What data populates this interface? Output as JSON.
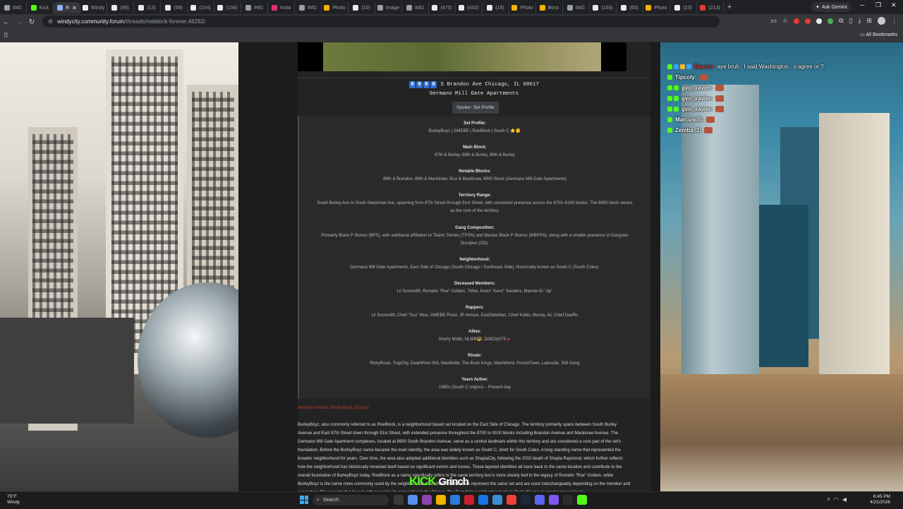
{
  "browser": {
    "tabs": [
      {
        "label": "IMG",
        "color": "#9aa0a6"
      },
      {
        "label": "Kick",
        "color": "#53fc18"
      },
      {
        "label": "R",
        "color": "#8ab4f8",
        "active": true
      },
      {
        "label": "Windy",
        "color": "#e8eaed"
      },
      {
        "label": "(99)",
        "color": "#e8eaed"
      },
      {
        "label": "(13)",
        "color": "#e8eaed"
      },
      {
        "label": "(59)",
        "color": "#e8eaed"
      },
      {
        "label": "(104)",
        "color": "#e8eaed"
      },
      {
        "label": "(156)",
        "color": "#e8eaed"
      },
      {
        "label": "IMG",
        "color": "#9aa0a6"
      },
      {
        "label": "Insta",
        "color": "#e1306c"
      },
      {
        "label": "IMG",
        "color": "#9aa0a6"
      },
      {
        "label": "Photo",
        "color": "#f4b400"
      },
      {
        "label": "(10)",
        "color": "#e8eaed"
      },
      {
        "label": "Image",
        "color": "#9aa0a6"
      },
      {
        "label": "IMG",
        "color": "#9aa0a6"
      },
      {
        "label": "(470)",
        "color": "#e8eaed"
      },
      {
        "label": "(432)",
        "color": "#e8eaed"
      },
      {
        "label": "(16)",
        "color": "#e8eaed"
      },
      {
        "label": "Photo",
        "color": "#f4b400"
      },
      {
        "label": "Boss",
        "color": "#f4b400"
      },
      {
        "label": "IMG",
        "color": "#9aa0a6"
      },
      {
        "label": "(159)",
        "color": "#e8eaed"
      },
      {
        "label": "(65)",
        "color": "#e8eaed"
      },
      {
        "label": "Photo",
        "color": "#f4b400"
      },
      {
        "label": "(23)",
        "color": "#e8eaed"
      },
      {
        "label": "(213)",
        "color": "#e53935"
      }
    ],
    "new_tab": "+",
    "ask_gemini": "Ask Gemini",
    "url_host": "windycity.community.forum",
    "url_path": "/threads/roeblock-forever.46262/",
    "all_bookmarks": "All Bookmarks"
  },
  "post": {
    "address_digits": [
      "8",
      "9",
      "0",
      "0"
    ],
    "address_rest": "S Brandon Ave Chicago, IL 60617",
    "complex": "Germano Mill Gate Apartments",
    "spoiler_button": "Spoiler: Set Profile",
    "sections": [
      {
        "heading": "Set Profile:",
        "text": "BurleyBoyz | GMEBE | RoeBlock | South C",
        "emoji": "⭐✊"
      },
      {
        "heading": "Main Block:",
        "text": "87th & Burley, 88th & Burley, 89th & Burley"
      },
      {
        "heading": "Notable Blocks:",
        "text": "88th & Brandon, 89th & Mackinaw, 91st & Mackinaw, 8900 Block (Germano Mill Gate Apartments)"
      },
      {
        "heading": "Territory Range:",
        "text": "South Burley Ave to South Mackinaw Ave, spanning from 87th Street through 91st Street, with consistent presence across the 8700–9100 blocks. The 8900 block serves as the core of the territory."
      },
      {
        "heading": "Gang Composition:",
        "text": "Primarily Black P Stones (BPS), with additional affiliation to Titanic Stones (TPSN) and Maniac Black P Stones (MBPSN), along with a smaller presence of Gangster Disciples (GD)."
      },
      {
        "heading": "Neighborhood:",
        "text": "Germano Mill Gate Apartments, East Side of Chicago (South Chicago / Southeast Side), historically known as South C (South Coles)."
      },
      {
        "heading": "Deceased Members:",
        "text": "Lil Scoom89, Romello \"Roe\" Golden, 7Moe, Kevin \"Kevo\" Sanders, Mannie-El \"Jip\""
      },
      {
        "heading": "Rappers:",
        "text": "Lil Scoom89, Chief \"Sco\" Moe, GMEBE Pistol, JP Armani, EastSideMari, Chief Kiddo, Murda, Ali, Chief DaeRo"
      },
      {
        "heading": "Allies:",
        "text": "Shorty Mobb, NLMB🔱, DrillCity079🔺"
      },
      {
        "heading": "Rivals:",
        "text": "RiskyRoad, TrapCity, DeathRow 083, MaxMobb, The Bush Kings, MainWorld, PocketTown, Lakeside, 358 Gang"
      },
      {
        "heading": "Years Active:",
        "text": "1980s (South C origins) – Present day"
      }
    ],
    "red_link": "Western Avenue: BurleyBoyz (Gangs)",
    "body_lines": [
      "BurleyBoyz, also commonly referred to as RoeBlock, is a neighborhood based set located on the East Side of Chicago. The territory primarily spans between South Burley",
      "Avenue and East 87th Street down through 91st Street, with extended presence throughout the 8700 to 9100 blocks including Brandon Avenue and Mackinaw Avenue. The",
      "Germano Mill Gate Apartment complexes, located at 8900 South Brandon Avenue, serve as a central landmark within this territory and are considered a core part of the set's",
      "foundation. Before the BurleyBoyz name became the main identity, the area was widely known as South C, short for South Coles. A long standing name that represented the",
      "broader neighborhood for years. Over time, the area also adopted additional identities such as ShaylaCity, following the 2010 death of Shayla Raymond, which further reflects",
      "how the neighborhood has historically renamed itself based on significant events and losses. These layered identities all trace back to the same location and contribute to the",
      "overall foundation of BurleyBoyz today. RoeBlock as a name specifically refers to the same territory but is more closely tied to the legacy of Romello \"Roe\" Golden, while",
      "BurleyBoyz is the name more commonly used by the neighborhood as a whole. Both names represent the same set and are used interchangeably depending on the member and",
      "generation. The area itself is heavily influenced by its connection to the Stones. The East Side neighborhood where BurleyBoyz is located is known for its"
    ]
  },
  "stream_overlay": {
    "kick_logo": "KICK",
    "streamer": "Grinch",
    "chat": [
      {
        "user": "BearsJ",
        "user_color": "#e53935",
        "message": "aye bruh.. I said Washington.. u agree or ?",
        "badges": [
          "b-kick",
          "b-blue",
          "b-gold",
          "b-blue"
        ]
      },
      {
        "user": "Tipcoly:",
        "user_color": "#ffffff",
        "emote": true,
        "badges": [
          "b-kick"
        ]
      },
      {
        "user": "gvo_xavier:",
        "user_color": "#ffffff",
        "emote": true,
        "badges": [
          "b-kick",
          "b-kick"
        ]
      },
      {
        "user": "gvo_xavier:",
        "user_color": "#ffffff",
        "emote": true,
        "badges": [
          "b-kick",
          "b-kick"
        ]
      },
      {
        "user": "gvo_xavier:",
        "user_color": "#ffffff",
        "emote": true,
        "badges": [
          "b-kick",
          "b-kick"
        ]
      },
      {
        "user": "Marcuso5:",
        "user_color": "#ffffff",
        "emote": true,
        "badges": [
          "b-kick"
        ]
      },
      {
        "user": "Zemba_1:",
        "user_color": "#ffffff",
        "emote": true,
        "badges": [
          "b-kick"
        ]
      }
    ]
  },
  "taskbar": {
    "weather_temp": "75°F",
    "weather_label": "Windy",
    "search_placeholder": "Search",
    "time": "6:45 PM",
    "date": "4/21/2026",
    "apps": [
      "#3a3a3a",
      "#5a8dee",
      "#8e44ad",
      "#f4b400",
      "#2b7bd9",
      "#cc1e2e",
      "#1a73e8",
      "#3c8dd8",
      "#ea4335",
      "#1b2838",
      "#5865f2",
      "#7f57f1",
      "#2d2d2d",
      "#53fc18"
    ]
  }
}
